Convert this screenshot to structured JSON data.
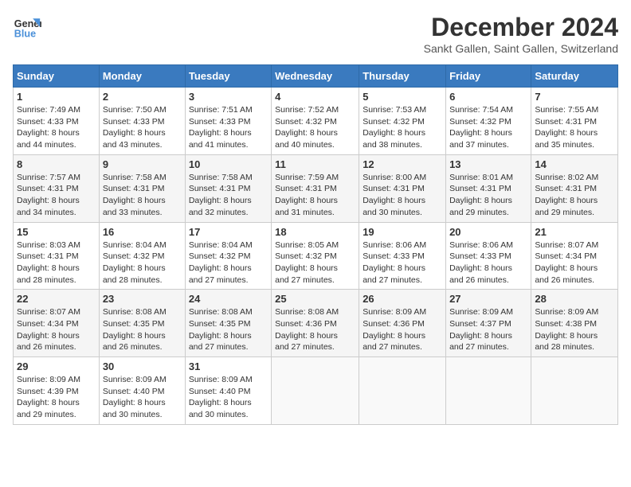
{
  "header": {
    "logo_line1": "General",
    "logo_line2": "Blue",
    "title": "December 2024",
    "subtitle": "Sankt Gallen, Saint Gallen, Switzerland"
  },
  "days_of_week": [
    "Sunday",
    "Monday",
    "Tuesday",
    "Wednesday",
    "Thursday",
    "Friday",
    "Saturday"
  ],
  "weeks": [
    [
      {
        "day": "1",
        "sunrise": "7:49 AM",
        "sunset": "4:33 PM",
        "daylight": "8 hours and 44 minutes."
      },
      {
        "day": "2",
        "sunrise": "7:50 AM",
        "sunset": "4:33 PM",
        "daylight": "8 hours and 43 minutes."
      },
      {
        "day": "3",
        "sunrise": "7:51 AM",
        "sunset": "4:33 PM",
        "daylight": "8 hours and 41 minutes."
      },
      {
        "day": "4",
        "sunrise": "7:52 AM",
        "sunset": "4:32 PM",
        "daylight": "8 hours and 40 minutes."
      },
      {
        "day": "5",
        "sunrise": "7:53 AM",
        "sunset": "4:32 PM",
        "daylight": "8 hours and 38 minutes."
      },
      {
        "day": "6",
        "sunrise": "7:54 AM",
        "sunset": "4:32 PM",
        "daylight": "8 hours and 37 minutes."
      },
      {
        "day": "7",
        "sunrise": "7:55 AM",
        "sunset": "4:31 PM",
        "daylight": "8 hours and 35 minutes."
      }
    ],
    [
      {
        "day": "8",
        "sunrise": "7:57 AM",
        "sunset": "4:31 PM",
        "daylight": "8 hours and 34 minutes."
      },
      {
        "day": "9",
        "sunrise": "7:58 AM",
        "sunset": "4:31 PM",
        "daylight": "8 hours and 33 minutes."
      },
      {
        "day": "10",
        "sunrise": "7:58 AM",
        "sunset": "4:31 PM",
        "daylight": "8 hours and 32 minutes."
      },
      {
        "day": "11",
        "sunrise": "7:59 AM",
        "sunset": "4:31 PM",
        "daylight": "8 hours and 31 minutes."
      },
      {
        "day": "12",
        "sunrise": "8:00 AM",
        "sunset": "4:31 PM",
        "daylight": "8 hours and 30 minutes."
      },
      {
        "day": "13",
        "sunrise": "8:01 AM",
        "sunset": "4:31 PM",
        "daylight": "8 hours and 29 minutes."
      },
      {
        "day": "14",
        "sunrise": "8:02 AM",
        "sunset": "4:31 PM",
        "daylight": "8 hours and 29 minutes."
      }
    ],
    [
      {
        "day": "15",
        "sunrise": "8:03 AM",
        "sunset": "4:31 PM",
        "daylight": "8 hours and 28 minutes."
      },
      {
        "day": "16",
        "sunrise": "8:04 AM",
        "sunset": "4:32 PM",
        "daylight": "8 hours and 28 minutes."
      },
      {
        "day": "17",
        "sunrise": "8:04 AM",
        "sunset": "4:32 PM",
        "daylight": "8 hours and 27 minutes."
      },
      {
        "day": "18",
        "sunrise": "8:05 AM",
        "sunset": "4:32 PM",
        "daylight": "8 hours and 27 minutes."
      },
      {
        "day": "19",
        "sunrise": "8:06 AM",
        "sunset": "4:33 PM",
        "daylight": "8 hours and 27 minutes."
      },
      {
        "day": "20",
        "sunrise": "8:06 AM",
        "sunset": "4:33 PM",
        "daylight": "8 hours and 26 minutes."
      },
      {
        "day": "21",
        "sunrise": "8:07 AM",
        "sunset": "4:34 PM",
        "daylight": "8 hours and 26 minutes."
      }
    ],
    [
      {
        "day": "22",
        "sunrise": "8:07 AM",
        "sunset": "4:34 PM",
        "daylight": "8 hours and 26 minutes."
      },
      {
        "day": "23",
        "sunrise": "8:08 AM",
        "sunset": "4:35 PM",
        "daylight": "8 hours and 26 minutes."
      },
      {
        "day": "24",
        "sunrise": "8:08 AM",
        "sunset": "4:35 PM",
        "daylight": "8 hours and 27 minutes."
      },
      {
        "day": "25",
        "sunrise": "8:08 AM",
        "sunset": "4:36 PM",
        "daylight": "8 hours and 27 minutes."
      },
      {
        "day": "26",
        "sunrise": "8:09 AM",
        "sunset": "4:36 PM",
        "daylight": "8 hours and 27 minutes."
      },
      {
        "day": "27",
        "sunrise": "8:09 AM",
        "sunset": "4:37 PM",
        "daylight": "8 hours and 27 minutes."
      },
      {
        "day": "28",
        "sunrise": "8:09 AM",
        "sunset": "4:38 PM",
        "daylight": "8 hours and 28 minutes."
      }
    ],
    [
      {
        "day": "29",
        "sunrise": "8:09 AM",
        "sunset": "4:39 PM",
        "daylight": "8 hours and 29 minutes."
      },
      {
        "day": "30",
        "sunrise": "8:09 AM",
        "sunset": "4:40 PM",
        "daylight": "8 hours and 30 minutes."
      },
      {
        "day": "31",
        "sunrise": "8:09 AM",
        "sunset": "4:40 PM",
        "daylight": "8 hours and 30 minutes."
      },
      null,
      null,
      null,
      null
    ]
  ]
}
